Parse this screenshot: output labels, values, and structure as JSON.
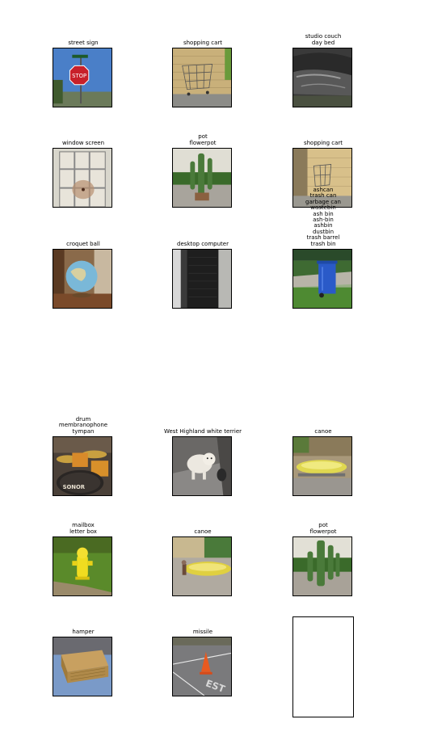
{
  "grid": {
    "captions": {
      "r0c0": "street sign",
      "r0c1": "shopping cart",
      "r0c2": "studio couch\nday bed",
      "r1c0": "window screen",
      "r1c1": "pot\nflowerpot",
      "r1c2": "shopping cart",
      "r2c0": "croquet ball",
      "r2c1": "desktop computer",
      "r2c2": "ashcan\ntrash can\ngarbage can\nwastebin\nash bin\nash-bin\nashbin\ndustbin\ntrash barrel\ntrash bin",
      "r3c0": "drum\nmembranophone\ntympan",
      "r3c1": "West Highland white terrier",
      "r3c2": "canoe",
      "r4c0": "mailbox\nletter box",
      "r4c1": "canoe",
      "r4c2": "pot\nflowerpot",
      "r5c0": "hamper",
      "r5c1": "missile"
    },
    "photo_text": {
      "stop_sign": "STOP",
      "drum_brand": "SONOR",
      "road_marking": "EST"
    }
  }
}
